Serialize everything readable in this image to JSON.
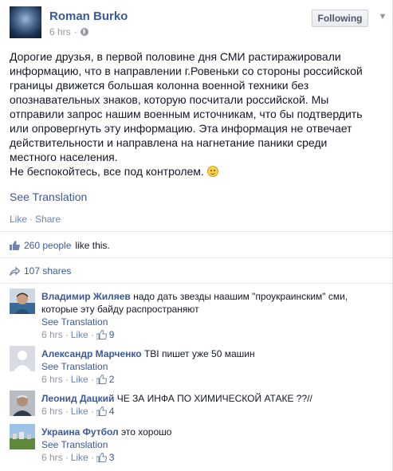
{
  "post": {
    "author": "Roman Burko",
    "time": "6 hrs",
    "meta_sep": "·",
    "follow_label": "Following",
    "text_lines": [
      "Дорогие друзья, в первой половине дня СМИ растиражировали",
      "информацию, что в направлении г.Ровеньки со стороны российской",
      "границы движется большая колонна военной техники без",
      "опознавательных знаков, которую посчитали российской. Мы",
      "отправили запрос нашим военным источникам, что бы подтвердить",
      "или опровергнуть эту информацию. Эта информация не отвечает",
      "действительности и направлена на нагнетание паники среди",
      "местного населения."
    ],
    "last_line": "Не беспокойтесь, все под контролем.",
    "see_translation": "See Translation",
    "like_action": "Like",
    "share_action": "Share",
    "action_sep": "·",
    "likes_link": "260 people",
    "likes_suffix": "like this.",
    "shares": "107 shares"
  },
  "comments": [
    {
      "name": "Владимир Жиляев",
      "text": "надо дать звезды наашим \"проукраинским\" сми, которые эту байду распространяют",
      "see_translation": "See Translation",
      "time": "6 hrs",
      "like": "Like",
      "likes": "9"
    },
    {
      "name": "Александр Марченко",
      "text": "ТВІ пишет уже 50 машин",
      "see_translation": "See Translation",
      "time": "6 hrs",
      "like": "Like",
      "likes": "2"
    },
    {
      "name": "Леонид Дацкий",
      "text": "ЧЕ ЗА ИНФА ПО ХИМИЧЕСКОЙ АТАКЕ ??//",
      "time": "6 hrs",
      "like": "Like",
      "likes": "4"
    },
    {
      "name": "Украина Футбол",
      "text": "это хорошо",
      "see_translation": "See Translation",
      "time": "6 hrs",
      "like": "Like",
      "likes": "3"
    }
  ],
  "meta_dot": "·",
  "colors": {
    "link": "#3b5998",
    "muted": "#9197a3",
    "text": "#141823"
  }
}
